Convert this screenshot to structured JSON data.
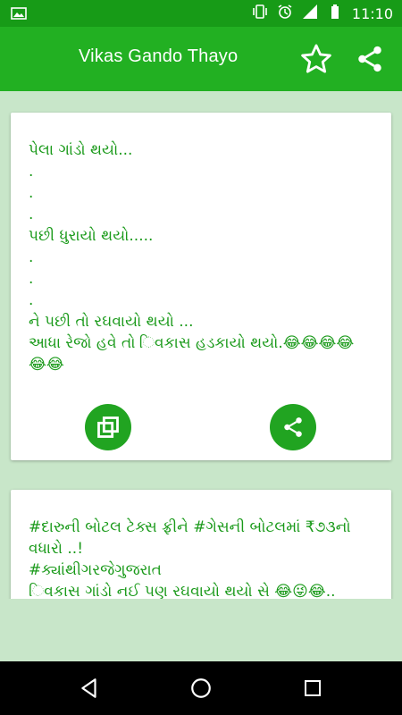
{
  "status_bar": {
    "time": "11:10",
    "icons": [
      "image-icon",
      "vibrate-icon",
      "alarm-icon",
      "signal-icon",
      "battery-icon"
    ]
  },
  "app_bar": {
    "title": "Vikas Gando Thayo",
    "actions": [
      "star-icon",
      "share-icon"
    ]
  },
  "cards": [
    {
      "text": " પેલા ગાંડો થયો...\n.\n.\n.\nપછી ધુરાયો થયો.....\n.\n.\n.\nને પછી તો રઘવાયો થયો ...\nઆધા રેજો હવે તો િવકાસ હડકાયો થયો.😂😂😂😂\n😂😂",
      "buttons": [
        "copy-icon",
        "share-icon"
      ]
    },
    {
      "text": " #દારુની બોટલ ટેક્સ ફ્રીને #ગેસની બોટલમાં ₹૭૩નો વધારો ..!\n#ક્યાંથીગરજેગુજરાત\nિવકાસ ગાંડો નઈ પણ રઘવાયો થયો સે  😂😜😂.."
    }
  ],
  "nav_bar": {
    "buttons": [
      "back-icon",
      "home-icon",
      "recent-apps-icon"
    ]
  },
  "colors": {
    "status_bar": "#179b17",
    "app_bar": "#22b022",
    "accent_text": "#1a9a1a",
    "background": "#c8e6c9"
  }
}
